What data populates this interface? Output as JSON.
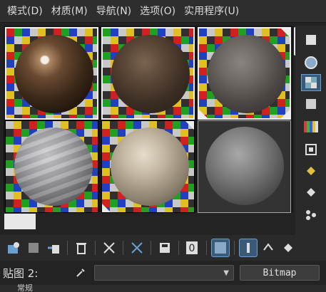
{
  "menu": {
    "items": [
      "模式(D)",
      "材质(M)",
      "导航(N)",
      "选项(O)",
      "实用程序(U)"
    ]
  },
  "slots": [
    {
      "name": "slot-1",
      "material": "dark-glossy-wood",
      "selected": true
    },
    {
      "name": "slot-2",
      "material": "dark-brown-leather",
      "selected": true
    },
    {
      "name": "slot-3",
      "material": "dark-gray-fabric",
      "selected": true
    },
    {
      "name": "slot-4",
      "material": "gray-marble",
      "selected": false
    },
    {
      "name": "slot-5",
      "material": "beige-textured",
      "selected": false
    },
    {
      "name": "slot-6",
      "material": "gray-default",
      "selected": false
    }
  ],
  "maprow": {
    "label": "贴图 2:",
    "selected_value": "",
    "map_type": "Bitmap"
  },
  "bottom": {
    "partial_label": "常规"
  },
  "colors": {
    "background": "#232323",
    "accent": "#6aa0d0",
    "selected_border": "#f0f0f0"
  }
}
